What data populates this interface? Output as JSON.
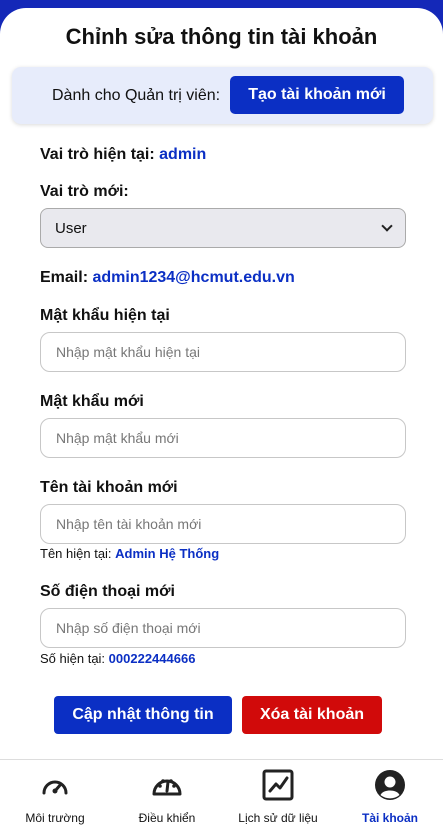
{
  "title": "Chỉnh sửa thông tin tài khoản",
  "admin": {
    "label": "Dành cho Quản trị viên:",
    "create_button": "Tạo tài khoản mới"
  },
  "role": {
    "current_label": "Vai trò hiện tại:",
    "current_value": "admin",
    "new_label": "Vai trò mới:",
    "selected": "User"
  },
  "email": {
    "label": "Email:",
    "value": "admin1234@hcmut.edu.vn"
  },
  "current_password": {
    "label": "Mật khẩu hiện tại",
    "placeholder": "Nhập mật khẩu hiện tại"
  },
  "new_password": {
    "label": "Mật khẩu mới",
    "placeholder": "Nhập mật khẩu mới"
  },
  "username": {
    "label": "Tên tài khoản mới",
    "placeholder": "Nhập tên tài khoản mới",
    "current_label": "Tên hiện tại:",
    "current_value": "Admin Hệ Thống"
  },
  "phone": {
    "label": "Số điện thoại mới",
    "placeholder": "Nhập số điện thoại mới",
    "current_label": "Số hiện tại:",
    "current_value": "000222444666"
  },
  "actions": {
    "update": "Cập nhật thông tin",
    "delete": "Xóa tài khoản"
  },
  "nav": {
    "items": [
      {
        "label": "Môi trường",
        "icon": "gauge-icon"
      },
      {
        "label": "Điều khiển",
        "icon": "dashboard-icon"
      },
      {
        "label": "Lịch sử dữ liệu",
        "icon": "chart-line-icon"
      },
      {
        "label": "Tài khoản",
        "icon": "user-circle-icon",
        "active": true
      }
    ]
  },
  "colors": {
    "primary": "#0b2fc4",
    "danger": "#d10a0a",
    "header_bg": "#1428b8",
    "admin_box": "#e7ecfb"
  }
}
